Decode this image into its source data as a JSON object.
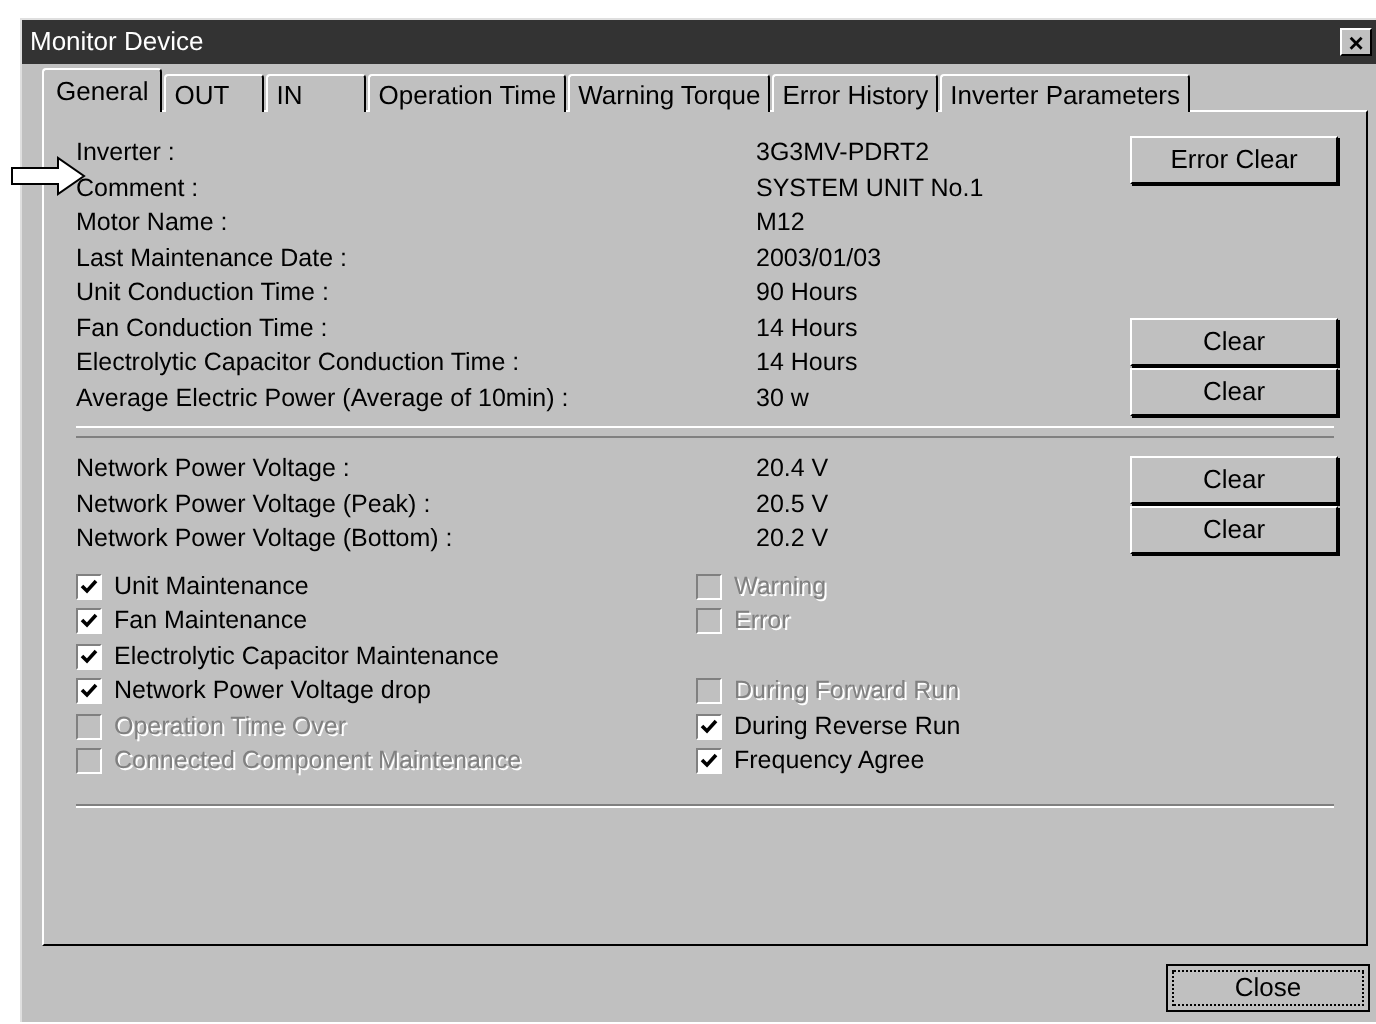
{
  "window": {
    "title": "Monitor Device",
    "close": "×"
  },
  "tabs": [
    {
      "label": "General",
      "selected": true
    },
    {
      "label": "OUT",
      "selected": false
    },
    {
      "label": "IN",
      "selected": false
    },
    {
      "label": "Operation Time",
      "selected": false
    },
    {
      "label": "Warning Torque",
      "selected": false
    },
    {
      "label": "Error History",
      "selected": false
    },
    {
      "label": "Inverter Parameters",
      "selected": false
    }
  ],
  "sections": [
    {
      "rows": [
        {
          "label": "Inverter :",
          "value": "3G3MV-PDRT2"
        },
        {
          "label": "Comment :",
          "value": "SYSTEM UNIT No.1"
        },
        {
          "label": "Motor Name :",
          "value": "M12"
        },
        {
          "label": "Last Maintenance Date :",
          "value": "2003/01/03"
        },
        {
          "label": "Unit Conduction Time :",
          "value": "90 Hours"
        },
        {
          "label": "Fan Conduction Time :",
          "value": "14 Hours"
        },
        {
          "label": "Electrolytic Capacitor Conduction Time :",
          "value": "14 Hours"
        },
        {
          "label": "Average Electric Power (Average of 10min) :",
          "value": "30 w"
        }
      ],
      "button_groups": [
        [
          "Error Clear"
        ],
        [
          "Clear",
          "Clear"
        ]
      ]
    },
    {
      "rows": [
        {
          "label": "Network Power Voltage :",
          "value": "20.4 V"
        },
        {
          "label": "Network Power Voltage (Peak) :",
          "value": "20.5 V"
        },
        {
          "label": "Network Power Voltage (Bottom) :",
          "value": "20.2 V"
        }
      ],
      "button_groups": [
        [
          "Clear",
          "Clear"
        ]
      ]
    }
  ],
  "checks_left": [
    {
      "label": "Unit Maintenance",
      "checked": true,
      "disabled": false
    },
    {
      "label": "Fan Maintenance",
      "checked": true,
      "disabled": false
    },
    {
      "label": "Electrolytic Capacitor Maintenance",
      "checked": true,
      "disabled": false
    },
    {
      "label": "Network Power Voltage drop",
      "checked": true,
      "disabled": false
    },
    {
      "label": "Operation Time Over",
      "checked": false,
      "disabled": true
    },
    {
      "label": "Connected Component Maintenance",
      "checked": false,
      "disabled": true
    }
  ],
  "checks_right": [
    [
      {
        "label": "Warning",
        "checked": false,
        "disabled": true
      },
      {
        "label": "Error",
        "checked": false,
        "disabled": true
      }
    ],
    [
      {
        "label": "During Forward Run",
        "checked": false,
        "disabled": true
      },
      {
        "label": "During Reverse Run",
        "checked": true,
        "disabled": false
      },
      {
        "label": "Frequency Agree",
        "checked": true,
        "disabled": false
      }
    ]
  ],
  "close_button": "Close"
}
